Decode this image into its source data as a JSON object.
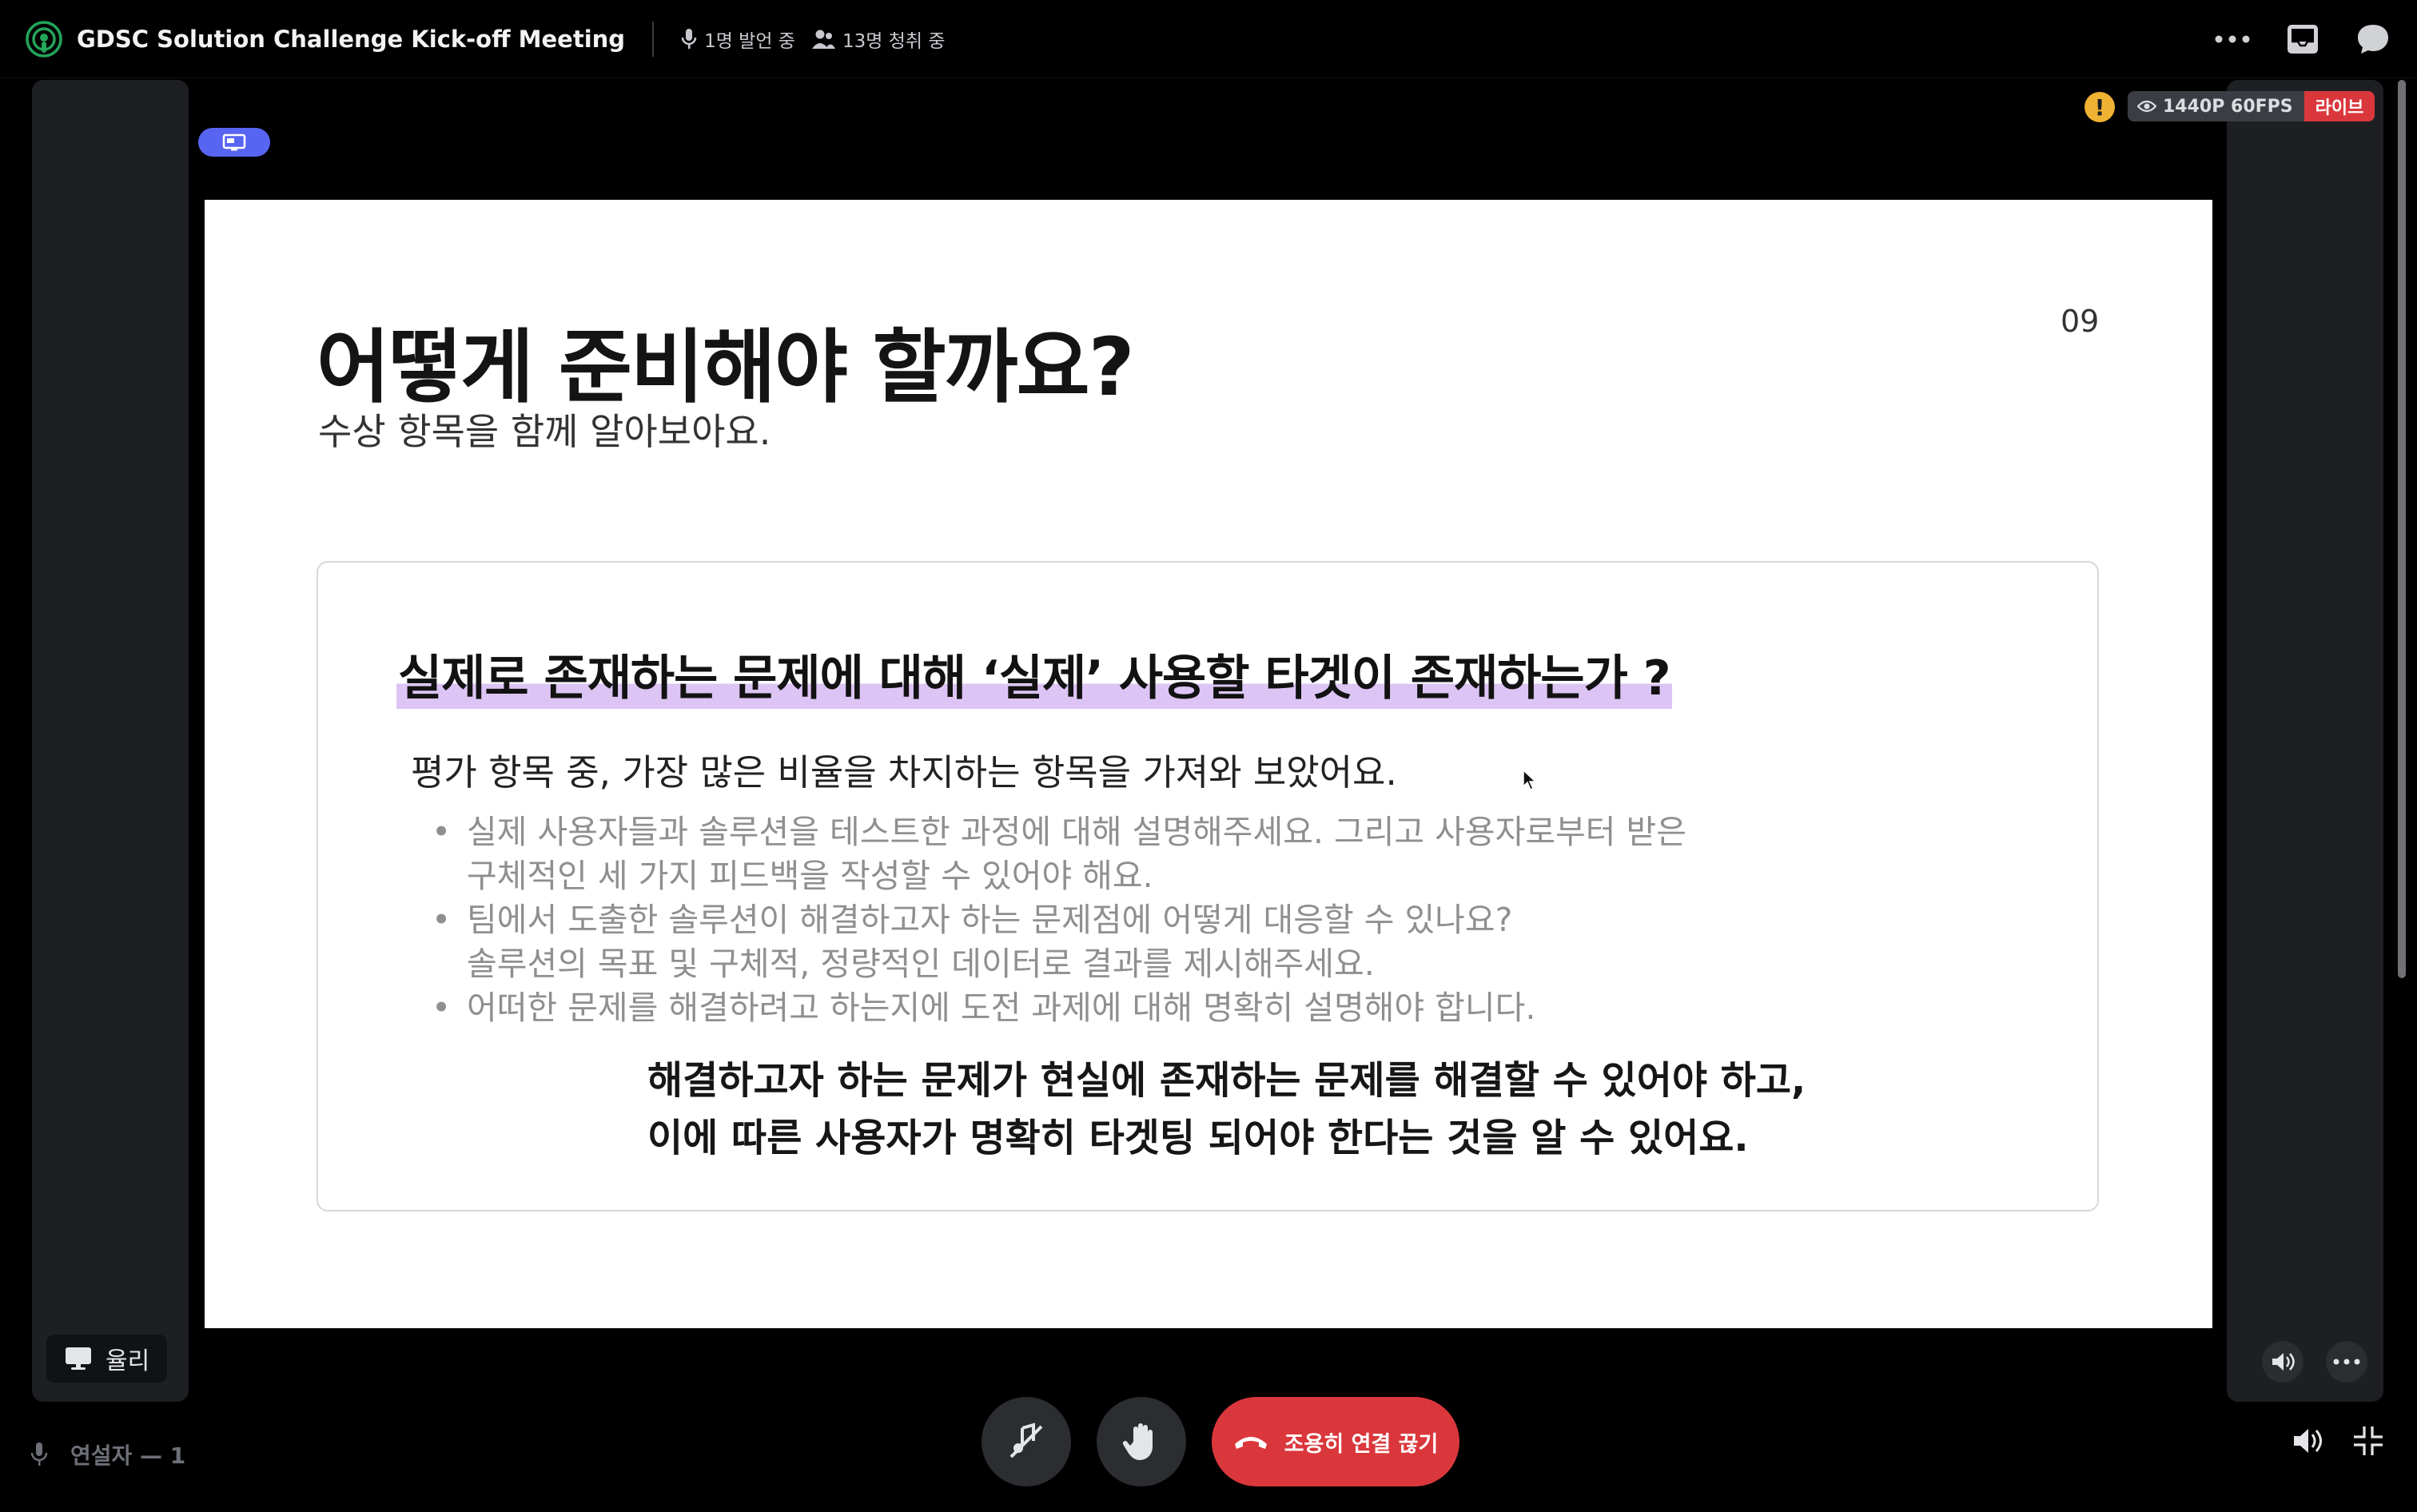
{
  "header": {
    "title": "GDSC Solution Challenge Kick-off Meeting",
    "speaking_count": "1명 발언 중",
    "listening_count": "13명 청취 중"
  },
  "stream": {
    "quality": "1440P 60FPS",
    "live_label": "라이브",
    "warning_glyph": "!"
  },
  "slide": {
    "title": "어떻게 준비해야 할까요?",
    "subtitle": "수상 항목을 함께 알아보아요.",
    "page_number": "09",
    "question": "실제로 존재하는 문제에 대해 ‘실제’ 사용할 타겟이 존재하는가 ?",
    "lead": "평가 항목 중, 가장 많은 비율을 차지하는 항목을 가져와 보았어요.",
    "bullets": [
      "실제 사용자들과 솔루션을 테스트한 과정에 대해 설명해주세요. 그리고 사용자로부터 받은\n구체적인 세 가지 피드백을 작성할 수 있어야 해요.",
      "팀에서 도출한 솔루션이 해결하고자 하는 문제점에 어떻게 대응할 수 있나요?\n솔루션의 목표 및 구체적, 정량적인 데이터로 결과를 제시해주세요.",
      "어떠한 문제를 해결하려고 하는지에 도전 과제에 대해 명확히 설명해야 합니다."
    ],
    "conclusion_line1": "해결하고자 하는 문제가 현실에 존재하는 문제를 해결할 수 있어야 하고,",
    "conclusion_line2": "이에 따른 사용자가 명확히 타겟팅 되어야 한다는 것을 알 수 있어요."
  },
  "tile": {
    "streamer_name": "율리"
  },
  "bottom": {
    "speakers_label": "연설자 — 1",
    "leave_label": "조용히 연결 끊기"
  },
  "colors": {
    "accent": "#5865f2",
    "danger": "#da373c",
    "highlight": "#dcc5f5",
    "stage_green": "#23a55a",
    "warning": "#f0b232"
  },
  "icons": [
    "stage-icon",
    "microphone-icon",
    "listeners-icon",
    "more-icon",
    "inbox-icon",
    "chat-icon",
    "screen-share-icon",
    "eye-icon",
    "monitor-icon",
    "speaker-icon",
    "mic-off-icon",
    "raise-hand-icon",
    "phone-hangup-icon",
    "volume-icon",
    "minimize-icon",
    "cursor-icon"
  ]
}
